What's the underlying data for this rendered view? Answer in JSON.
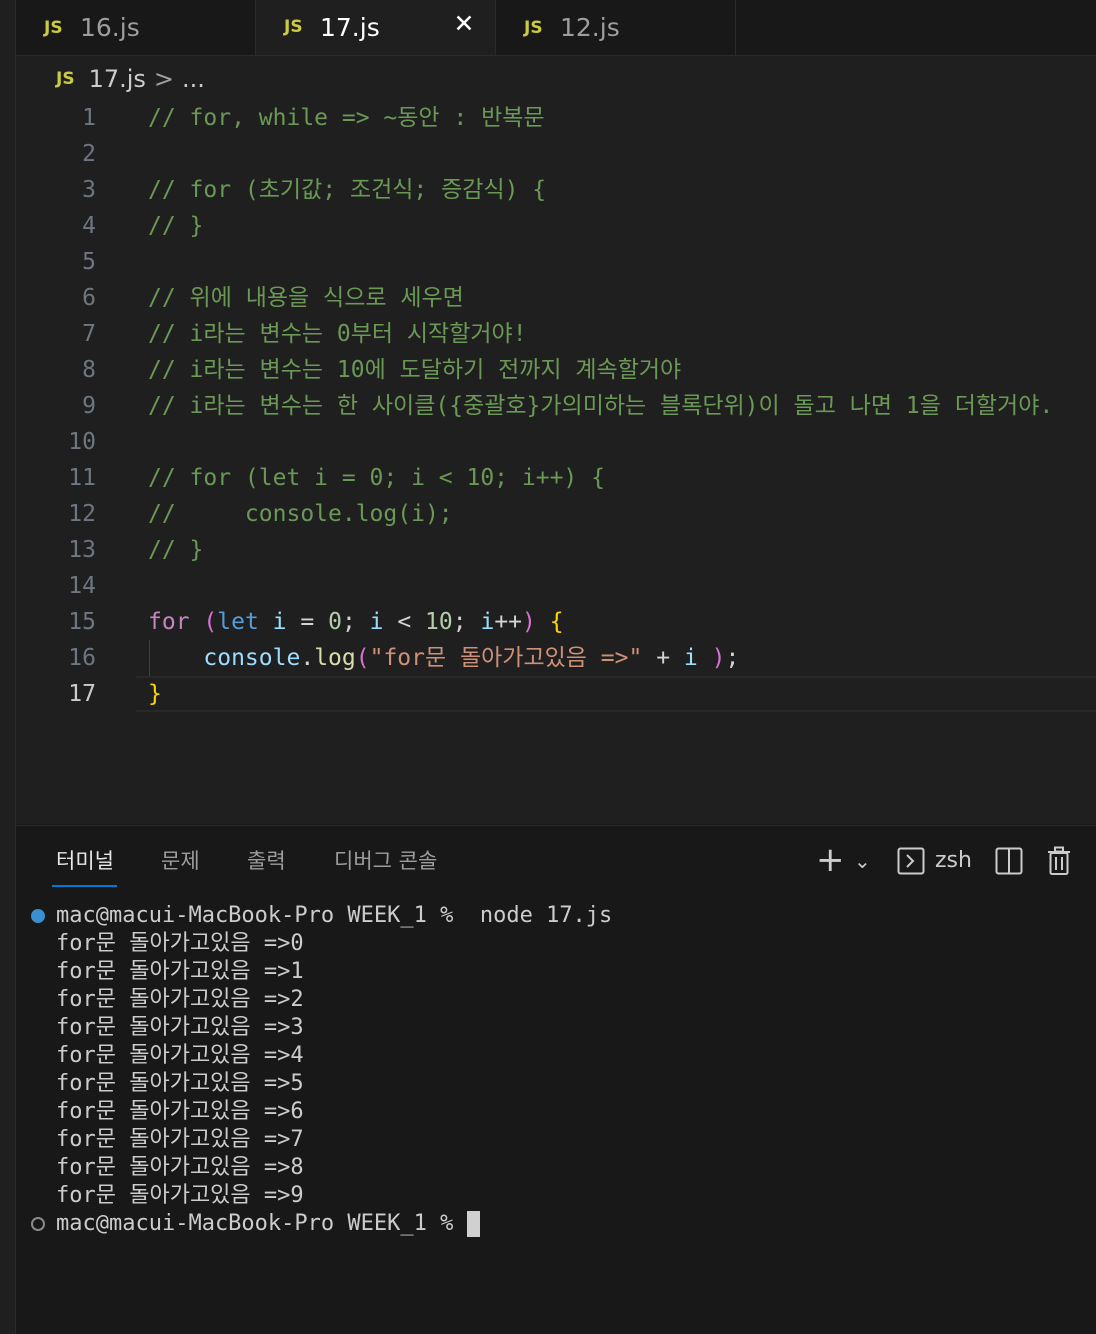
{
  "tabs": [
    {
      "badge": "JS",
      "name": "16.js",
      "active": false
    },
    {
      "badge": "JS",
      "name": "17.js",
      "active": true,
      "close": "✕"
    },
    {
      "badge": "JS",
      "name": "12.js",
      "active": false
    }
  ],
  "breadcrumb": {
    "badge": "JS",
    "file": "17.js",
    "separator": ">",
    "more": "..."
  },
  "editor": {
    "current_line": 17,
    "lines": [
      {
        "n": "1",
        "tokens": [
          {
            "t": "// for, while => ~동안 : 반복문",
            "c": "com"
          }
        ]
      },
      {
        "n": "2",
        "tokens": []
      },
      {
        "n": "3",
        "tokens": [
          {
            "t": "// for (초기값; 조건식; 증감식) {",
            "c": "com"
          }
        ]
      },
      {
        "n": "4",
        "tokens": [
          {
            "t": "// }",
            "c": "com"
          }
        ]
      },
      {
        "n": "5",
        "tokens": []
      },
      {
        "n": "6",
        "tokens": [
          {
            "t": "// 위에 내용을 식으로 세우면",
            "c": "com"
          }
        ]
      },
      {
        "n": "7",
        "tokens": [
          {
            "t": "// i라는 변수는 0부터 시작할거야!",
            "c": "com"
          }
        ]
      },
      {
        "n": "8",
        "tokens": [
          {
            "t": "// i라는 변수는 10에 도달하기 전까지 계속할거야",
            "c": "com"
          }
        ]
      },
      {
        "n": "9",
        "tokens": [
          {
            "t": "// i라는 변수는 한 사이클({중괄호}가의미하는 블록단위)이 돌고 나면 1을 더할거야.",
            "c": "com"
          }
        ]
      },
      {
        "n": "10",
        "tokens": []
      },
      {
        "n": "11",
        "tokens": [
          {
            "t": "// for (let i = 0; i < 10; i++) {",
            "c": "com"
          }
        ]
      },
      {
        "n": "12",
        "tokens": [
          {
            "t": "//     console.log(i);",
            "c": "com"
          }
        ]
      },
      {
        "n": "13",
        "tokens": [
          {
            "t": "// }",
            "c": "com"
          }
        ]
      },
      {
        "n": "14",
        "tokens": []
      },
      {
        "n": "15",
        "tokens": [
          {
            "t": "for",
            "c": "kw"
          },
          {
            "t": " ",
            "c": "pun"
          },
          {
            "t": "(",
            "c": "brk2"
          },
          {
            "t": "let",
            "c": "st"
          },
          {
            "t": " ",
            "c": "pun"
          },
          {
            "t": "i",
            "c": "var"
          },
          {
            "t": " = ",
            "c": "pun"
          },
          {
            "t": "0",
            "c": "num"
          },
          {
            "t": "; ",
            "c": "pun"
          },
          {
            "t": "i",
            "c": "var"
          },
          {
            "t": " < ",
            "c": "pun"
          },
          {
            "t": "10",
            "c": "num"
          },
          {
            "t": "; ",
            "c": "pun"
          },
          {
            "t": "i",
            "c": "var"
          },
          {
            "t": "++",
            "c": "pun"
          },
          {
            "t": ")",
            "c": "brk2"
          },
          {
            "t": " ",
            "c": "pun"
          },
          {
            "t": "{",
            "c": "brk1"
          }
        ]
      },
      {
        "n": "16",
        "tokens": [
          {
            "t": "    ",
            "c": "pun"
          },
          {
            "t": "console",
            "c": "var"
          },
          {
            "t": ".",
            "c": "pun"
          },
          {
            "t": "log",
            "c": "fn"
          },
          {
            "t": "(",
            "c": "brk2"
          },
          {
            "t": "\"for문 돌아가고있음 =>\"",
            "c": "str"
          },
          {
            "t": " + ",
            "c": "pun"
          },
          {
            "t": "i",
            "c": "var"
          },
          {
            "t": " ",
            "c": "pun"
          },
          {
            "t": ")",
            "c": "brk2"
          },
          {
            "t": ";",
            "c": "pun"
          }
        ]
      },
      {
        "n": "17",
        "tokens": [
          {
            "t": "}",
            "c": "brk1"
          }
        ]
      }
    ]
  },
  "panel": {
    "tabs": [
      "터미널",
      "문제",
      "출력",
      "디버그 콘솔"
    ],
    "active_tab": "터미널",
    "actions": {
      "add": "+",
      "dropdown": "⌄",
      "shell": "zsh"
    },
    "terminal": {
      "command_line": {
        "prompt": "mac@macui-MacBook-Pro WEEK_1 %",
        "command": "node 17.js"
      },
      "output": [
        "for문 돌아가고있음 =>0",
        "for문 돌아가고있음 =>1",
        "for문 돌아가고있음 =>2",
        "for문 돌아가고있음 =>3",
        "for문 돌아가고있음 =>4",
        "for문 돌아가고있음 =>5",
        "for문 돌아가고있음 =>6",
        "for문 돌아가고있음 =>7",
        "for문 돌아가고있음 =>8",
        "for문 돌아가고있음 =>9"
      ],
      "final_prompt": "mac@macui-MacBook-Pro WEEK_1 %"
    }
  }
}
